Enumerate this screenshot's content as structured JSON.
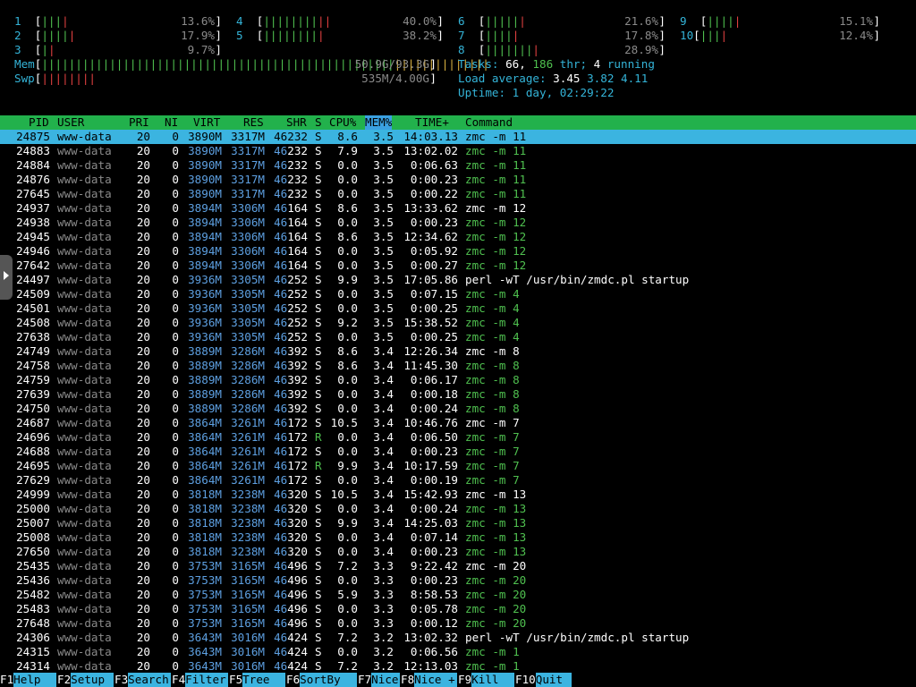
{
  "cpu_meters": [
    {
      "id": "1",
      "pct": "13.6%",
      "bars_red": "|",
      "bars_green": "|||"
    },
    {
      "id": "2",
      "pct": "17.9%",
      "bars_red": "|",
      "bars_green": "||||"
    },
    {
      "id": "3",
      "pct": "9.7%",
      "bars_red": "|",
      "bars_green": "|"
    },
    {
      "id": "4",
      "pct": "40.0%",
      "bars_red": "||",
      "bars_green": "||||||||"
    },
    {
      "id": "5",
      "pct": "38.2%",
      "bars_red": "|",
      "bars_green": "||||||||"
    },
    {
      "id": "6",
      "pct": "21.6%",
      "bars_red": "|",
      "bars_green": "|||||"
    },
    {
      "id": "7",
      "pct": "17.8%",
      "bars_red": "|",
      "bars_green": "||||"
    },
    {
      "id": "8",
      "pct": "28.9%",
      "bars_red": "|",
      "bars_green": "|||||||"
    },
    {
      "id": "9",
      "pct": "15.1%",
      "bars_red": "|",
      "bars_green": "||||"
    },
    {
      "id": "10",
      "pct": "12.4%",
      "bars_red": "|",
      "bars_green": "|||"
    }
  ],
  "mem": {
    "label": "Mem",
    "value": "50.9G/93.3G",
    "bars_green": "||||||||||||||||||||||||||||||||||||||||||||||||||||",
    "bars_yellow": "||||||||||||||"
  },
  "swp": {
    "label": "Swp",
    "value": "535M/4.00G",
    "bars_red": "||||||||"
  },
  "tasks": {
    "label": "Tasks:",
    "count": "66,",
    "thr": "186",
    "thr_label": "thr;",
    "running": "4",
    "running_label": "running"
  },
  "load": {
    "label": "Load average:",
    "l1": "3.45",
    "l5": "3.82",
    "l15": "4.11"
  },
  "uptime": {
    "label": "Uptime:",
    "value": "1 day, 02:29:22"
  },
  "columns": {
    "pid": "PID",
    "user": "USER",
    "pri": "PRI",
    "ni": "NI",
    "virt": "VIRT",
    "res": "RES",
    "shr": "SHR",
    "s": "S",
    "cpu": "CPU%",
    "mem": "MEM%",
    "time": "TIME+",
    "cmd": "Command"
  },
  "processes": [
    {
      "pid": "24875",
      "user": "www-data",
      "pri": "20",
      "ni": "0",
      "virt": "3890M",
      "res": "3317M",
      "shr": "46232",
      "s": "S",
      "cpu": "8.6",
      "mem": "3.5",
      "time": "14:03.13",
      "cmd": "zmc -m 11",
      "thread": false
    },
    {
      "pid": "24883",
      "user": "www-data",
      "pri": "20",
      "ni": "0",
      "virt": "3890M",
      "res": "3317M",
      "shr": "46232",
      "s": "S",
      "cpu": "7.9",
      "mem": "3.5",
      "time": "13:02.02",
      "cmd": "zmc -m 11",
      "thread": true
    },
    {
      "pid": "24884",
      "user": "www-data",
      "pri": "20",
      "ni": "0",
      "virt": "3890M",
      "res": "3317M",
      "shr": "46232",
      "s": "S",
      "cpu": "0.0",
      "mem": "3.5",
      "time": "0:06.63",
      "cmd": "zmc -m 11",
      "thread": true
    },
    {
      "pid": "24876",
      "user": "www-data",
      "pri": "20",
      "ni": "0",
      "virt": "3890M",
      "res": "3317M",
      "shr": "46232",
      "s": "S",
      "cpu": "0.0",
      "mem": "3.5",
      "time": "0:00.23",
      "cmd": "zmc -m 11",
      "thread": true
    },
    {
      "pid": "27645",
      "user": "www-data",
      "pri": "20",
      "ni": "0",
      "virt": "3890M",
      "res": "3317M",
      "shr": "46232",
      "s": "S",
      "cpu": "0.0",
      "mem": "3.5",
      "time": "0:00.22",
      "cmd": "zmc -m 11",
      "thread": true
    },
    {
      "pid": "24937",
      "user": "www-data",
      "pri": "20",
      "ni": "0",
      "virt": "3894M",
      "res": "3306M",
      "shr": "46164",
      "s": "S",
      "cpu": "8.6",
      "mem": "3.5",
      "time": "13:33.62",
      "cmd": "zmc -m 12",
      "thread": false
    },
    {
      "pid": "24938",
      "user": "www-data",
      "pri": "20",
      "ni": "0",
      "virt": "3894M",
      "res": "3306M",
      "shr": "46164",
      "s": "S",
      "cpu": "0.0",
      "mem": "3.5",
      "time": "0:00.23",
      "cmd": "zmc -m 12",
      "thread": true
    },
    {
      "pid": "24945",
      "user": "www-data",
      "pri": "20",
      "ni": "0",
      "virt": "3894M",
      "res": "3306M",
      "shr": "46164",
      "s": "S",
      "cpu": "8.6",
      "mem": "3.5",
      "time": "12:34.62",
      "cmd": "zmc -m 12",
      "thread": true
    },
    {
      "pid": "24946",
      "user": "www-data",
      "pri": "20",
      "ni": "0",
      "virt": "3894M",
      "res": "3306M",
      "shr": "46164",
      "s": "S",
      "cpu": "0.0",
      "mem": "3.5",
      "time": "0:05.92",
      "cmd": "zmc -m 12",
      "thread": true
    },
    {
      "pid": "27642",
      "user": "www-data",
      "pri": "20",
      "ni": "0",
      "virt": "3894M",
      "res": "3306M",
      "shr": "46164",
      "s": "S",
      "cpu": "0.0",
      "mem": "3.5",
      "time": "0:00.27",
      "cmd": "zmc -m 12",
      "thread": true
    },
    {
      "pid": "24497",
      "user": "www-data",
      "pri": "20",
      "ni": "0",
      "virt": "3936M",
      "res": "3305M",
      "shr": "46252",
      "s": "S",
      "cpu": "9.9",
      "mem": "3.5",
      "time": "17:05.86",
      "cmd": "perl -wT /usr/bin/zmdc.pl startup",
      "thread": false
    },
    {
      "pid": "24509",
      "user": "www-data",
      "pri": "20",
      "ni": "0",
      "virt": "3936M",
      "res": "3305M",
      "shr": "46252",
      "s": "S",
      "cpu": "0.0",
      "mem": "3.5",
      "time": "0:07.15",
      "cmd": "zmc -m 4",
      "thread": true
    },
    {
      "pid": "24501",
      "user": "www-data",
      "pri": "20",
      "ni": "0",
      "virt": "3936M",
      "res": "3305M",
      "shr": "46252",
      "s": "S",
      "cpu": "0.0",
      "mem": "3.5",
      "time": "0:00.25",
      "cmd": "zmc -m 4",
      "thread": true
    },
    {
      "pid": "24508",
      "user": "www-data",
      "pri": "20",
      "ni": "0",
      "virt": "3936M",
      "res": "3305M",
      "shr": "46252",
      "s": "S",
      "cpu": "9.2",
      "mem": "3.5",
      "time": "15:38.52",
      "cmd": "zmc -m 4",
      "thread": true
    },
    {
      "pid": "27638",
      "user": "www-data",
      "pri": "20",
      "ni": "0",
      "virt": "3936M",
      "res": "3305M",
      "shr": "46252",
      "s": "S",
      "cpu": "0.0",
      "mem": "3.5",
      "time": "0:00.25",
      "cmd": "zmc -m 4",
      "thread": true
    },
    {
      "pid": "24749",
      "user": "www-data",
      "pri": "20",
      "ni": "0",
      "virt": "3889M",
      "res": "3286M",
      "shr": "46392",
      "s": "S",
      "cpu": "8.6",
      "mem": "3.4",
      "time": "12:26.34",
      "cmd": "zmc -m 8",
      "thread": false
    },
    {
      "pid": "24758",
      "user": "www-data",
      "pri": "20",
      "ni": "0",
      "virt": "3889M",
      "res": "3286M",
      "shr": "46392",
      "s": "S",
      "cpu": "8.6",
      "mem": "3.4",
      "time": "11:45.30",
      "cmd": "zmc -m 8",
      "thread": true
    },
    {
      "pid": "24759",
      "user": "www-data",
      "pri": "20",
      "ni": "0",
      "virt": "3889M",
      "res": "3286M",
      "shr": "46392",
      "s": "S",
      "cpu": "0.0",
      "mem": "3.4",
      "time": "0:06.17",
      "cmd": "zmc -m 8",
      "thread": true
    },
    {
      "pid": "27639",
      "user": "www-data",
      "pri": "20",
      "ni": "0",
      "virt": "3889M",
      "res": "3286M",
      "shr": "46392",
      "s": "S",
      "cpu": "0.0",
      "mem": "3.4",
      "time": "0:00.18",
      "cmd": "zmc -m 8",
      "thread": true
    },
    {
      "pid": "24750",
      "user": "www-data",
      "pri": "20",
      "ni": "0",
      "virt": "3889M",
      "res": "3286M",
      "shr": "46392",
      "s": "S",
      "cpu": "0.0",
      "mem": "3.4",
      "time": "0:00.24",
      "cmd": "zmc -m 8",
      "thread": true
    },
    {
      "pid": "24687",
      "user": "www-data",
      "pri": "20",
      "ni": "0",
      "virt": "3864M",
      "res": "3261M",
      "shr": "46172",
      "s": "S",
      "cpu": "10.5",
      "mem": "3.4",
      "time": "10:46.76",
      "cmd": "zmc -m 7",
      "thread": false
    },
    {
      "pid": "24696",
      "user": "www-data",
      "pri": "20",
      "ni": "0",
      "virt": "3864M",
      "res": "3261M",
      "shr": "46172",
      "s": "R",
      "cpu": "0.0",
      "mem": "3.4",
      "time": "0:06.50",
      "cmd": "zmc -m 7",
      "thread": true
    },
    {
      "pid": "24688",
      "user": "www-data",
      "pri": "20",
      "ni": "0",
      "virt": "3864M",
      "res": "3261M",
      "shr": "46172",
      "s": "S",
      "cpu": "0.0",
      "mem": "3.4",
      "time": "0:00.23",
      "cmd": "zmc -m 7",
      "thread": true
    },
    {
      "pid": "24695",
      "user": "www-data",
      "pri": "20",
      "ni": "0",
      "virt": "3864M",
      "res": "3261M",
      "shr": "46172",
      "s": "R",
      "cpu": "9.9",
      "mem": "3.4",
      "time": "10:17.59",
      "cmd": "zmc -m 7",
      "thread": true
    },
    {
      "pid": "27629",
      "user": "www-data",
      "pri": "20",
      "ni": "0",
      "virt": "3864M",
      "res": "3261M",
      "shr": "46172",
      "s": "S",
      "cpu": "0.0",
      "mem": "3.4",
      "time": "0:00.19",
      "cmd": "zmc -m 7",
      "thread": true
    },
    {
      "pid": "24999",
      "user": "www-data",
      "pri": "20",
      "ni": "0",
      "virt": "3818M",
      "res": "3238M",
      "shr": "46320",
      "s": "S",
      "cpu": "10.5",
      "mem": "3.4",
      "time": "15:42.93",
      "cmd": "zmc -m 13",
      "thread": false
    },
    {
      "pid": "25000",
      "user": "www-data",
      "pri": "20",
      "ni": "0",
      "virt": "3818M",
      "res": "3238M",
      "shr": "46320",
      "s": "S",
      "cpu": "0.0",
      "mem": "3.4",
      "time": "0:00.24",
      "cmd": "zmc -m 13",
      "thread": true
    },
    {
      "pid": "25007",
      "user": "www-data",
      "pri": "20",
      "ni": "0",
      "virt": "3818M",
      "res": "3238M",
      "shr": "46320",
      "s": "S",
      "cpu": "9.9",
      "mem": "3.4",
      "time": "14:25.03",
      "cmd": "zmc -m 13",
      "thread": true
    },
    {
      "pid": "25008",
      "user": "www-data",
      "pri": "20",
      "ni": "0",
      "virt": "3818M",
      "res": "3238M",
      "shr": "46320",
      "s": "S",
      "cpu": "0.0",
      "mem": "3.4",
      "time": "0:07.14",
      "cmd": "zmc -m 13",
      "thread": true
    },
    {
      "pid": "27650",
      "user": "www-data",
      "pri": "20",
      "ni": "0",
      "virt": "3818M",
      "res": "3238M",
      "shr": "46320",
      "s": "S",
      "cpu": "0.0",
      "mem": "3.4",
      "time": "0:00.23",
      "cmd": "zmc -m 13",
      "thread": true
    },
    {
      "pid": "25435",
      "user": "www-data",
      "pri": "20",
      "ni": "0",
      "virt": "3753M",
      "res": "3165M",
      "shr": "46496",
      "s": "S",
      "cpu": "7.2",
      "mem": "3.3",
      "time": "9:22.42",
      "cmd": "zmc -m 20",
      "thread": false
    },
    {
      "pid": "25436",
      "user": "www-data",
      "pri": "20",
      "ni": "0",
      "virt": "3753M",
      "res": "3165M",
      "shr": "46496",
      "s": "S",
      "cpu": "0.0",
      "mem": "3.3",
      "time": "0:00.23",
      "cmd": "zmc -m 20",
      "thread": true
    },
    {
      "pid": "25482",
      "user": "www-data",
      "pri": "20",
      "ni": "0",
      "virt": "3753M",
      "res": "3165M",
      "shr": "46496",
      "s": "S",
      "cpu": "5.9",
      "mem": "3.3",
      "time": "8:58.53",
      "cmd": "zmc -m 20",
      "thread": true
    },
    {
      "pid": "25483",
      "user": "www-data",
      "pri": "20",
      "ni": "0",
      "virt": "3753M",
      "res": "3165M",
      "shr": "46496",
      "s": "S",
      "cpu": "0.0",
      "mem": "3.3",
      "time": "0:05.78",
      "cmd": "zmc -m 20",
      "thread": true
    },
    {
      "pid": "27648",
      "user": "www-data",
      "pri": "20",
      "ni": "0",
      "virt": "3753M",
      "res": "3165M",
      "shr": "46496",
      "s": "S",
      "cpu": "0.0",
      "mem": "3.3",
      "time": "0:00.12",
      "cmd": "zmc -m 20",
      "thread": true
    },
    {
      "pid": "24306",
      "user": "www-data",
      "pri": "20",
      "ni": "0",
      "virt": "3643M",
      "res": "3016M",
      "shr": "46424",
      "s": "S",
      "cpu": "7.2",
      "mem": "3.2",
      "time": "13:02.32",
      "cmd": "perl -wT /usr/bin/zmdc.pl startup",
      "thread": false
    },
    {
      "pid": "24315",
      "user": "www-data",
      "pri": "20",
      "ni": "0",
      "virt": "3643M",
      "res": "3016M",
      "shr": "46424",
      "s": "S",
      "cpu": "0.0",
      "mem": "3.2",
      "time": "0:06.56",
      "cmd": "zmc -m 1",
      "thread": true
    },
    {
      "pid": "24314",
      "user": "www-data",
      "pri": "20",
      "ni": "0",
      "virt": "3643M",
      "res": "3016M",
      "shr": "46424",
      "s": "S",
      "cpu": "7.2",
      "mem": "3.2",
      "time": "12:13.03",
      "cmd": "zmc -m 1",
      "thread": true
    }
  ],
  "fkeys": [
    {
      "key": "F1",
      "label": "Help"
    },
    {
      "key": "F2",
      "label": "Setup"
    },
    {
      "key": "F3",
      "label": "Search"
    },
    {
      "key": "F4",
      "label": "Filter"
    },
    {
      "key": "F5",
      "label": "Tree"
    },
    {
      "key": "F6",
      "label": "SortBy"
    },
    {
      "key": "F7",
      "label": "Nice -"
    },
    {
      "key": "F8",
      "label": "Nice +"
    },
    {
      "key": "F9",
      "label": "Kill"
    },
    {
      "key": "F10",
      "label": "Quit"
    }
  ]
}
